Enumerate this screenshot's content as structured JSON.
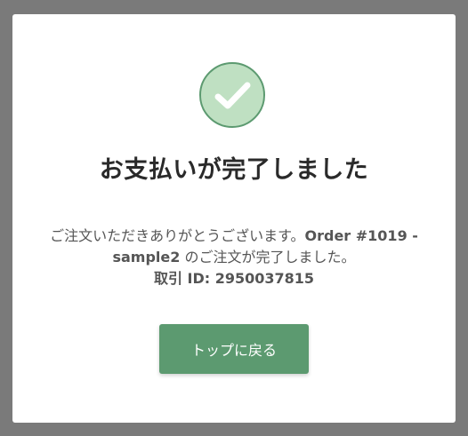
{
  "dialog": {
    "title": "お支払いが完了しました",
    "message": {
      "lead": "ご注文いただきありがとうございます。",
      "order_ref": "Order #1019 - sample2",
      "mid": " のご注文が完了しました。",
      "txn_label": "取引 ID: 2950037815"
    },
    "button_label": "トップに戻る",
    "icon": "checkmark-icon"
  },
  "colors": {
    "overlay": "#7a7a7a",
    "accent": "#5c9a70",
    "icon_fill": "#bfe0c2",
    "title": "#2a2a2a",
    "text": "#555555"
  }
}
